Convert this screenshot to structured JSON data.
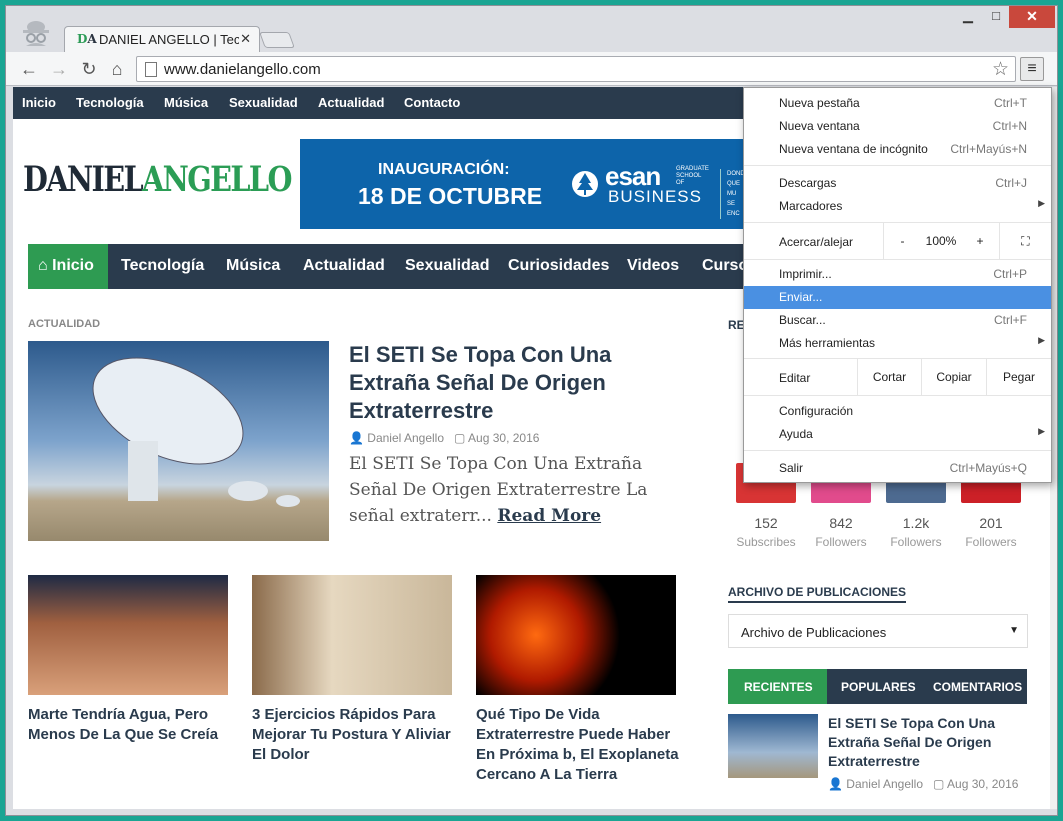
{
  "browser": {
    "tab_title": "DANIEL ANGELLO | Tecnología",
    "tab_favicon": "DA",
    "url": "www.danielangello.com"
  },
  "site": {
    "top_nav": [
      "Inicio",
      "Tecnología",
      "Música",
      "Sexualidad",
      "Actualidad",
      "Contacto"
    ],
    "logo_part1": "DANIEL",
    "logo_part2": "ANGELLO",
    "banner": {
      "line1": "INAUGURACIÓN:",
      "line2": "18 DE OCTUBRE",
      "brand": "esan",
      "brand2": "BUSINESS",
      "tag": "GRADUATE SCHOOL OF",
      "side": [
        "DONDE",
        "QUE MU",
        "SE ENC"
      ]
    },
    "main_nav": [
      "Inicio",
      "Tecnología",
      "Música",
      "Actualidad",
      "Sexualidad",
      "Curiosidades",
      "Videos",
      "Cursos"
    ],
    "section_label": "ACTUALIDAD",
    "featured": {
      "title": "El SETI Se Topa Con Una Extraña Señal De Origen Extraterrestre",
      "author": "Daniel Angello",
      "date": "Aug 30, 2016",
      "excerpt": "El SETI Se Topa Con Una Extraña Señal De Origen Extraterrestre La señal extraterr...",
      "read_more": "Read More"
    },
    "posts": [
      "Marte Tendría Agua, Pero Menos De La Que Se Creía",
      "3 Ejercicios Rápidos Para Mejorar Tu Postura Y Aliviar El Dolor",
      "Qué Tipo De Vida Extraterrestre Puede Haber En Próxima b, El Exoplaneta Cercano A La Tierra"
    ],
    "sidebar_heading_partial": "RE",
    "social": [
      {
        "count": "152",
        "label": "Subscribes",
        "color": "#d83434"
      },
      {
        "count": "842",
        "label": "Followers",
        "color": "#e14b8c"
      },
      {
        "count": "1.2k",
        "label": "Followers",
        "color": "#4d6a90"
      },
      {
        "count": "201",
        "label": "Followers",
        "color": "#cc2027"
      }
    ],
    "archive_heading": "ARCHIVO DE PUBLICACIONES",
    "archive_select": "Archivo de Publicaciones",
    "tabs": [
      "RECIENTES",
      "POPULARES",
      "COMENTARIOS"
    ],
    "recent": {
      "title": "El SETI Se Topa Con Una Extraña Señal De Origen Extraterrestre",
      "author": "Daniel Angello",
      "date": "Aug 30, 2016"
    }
  },
  "menu": {
    "new_tab": "Nueva pestaña",
    "new_tab_sc": "Ctrl+T",
    "new_window": "Nueva ventana",
    "new_window_sc": "Ctrl+N",
    "incognito": "Nueva ventana de incógnito",
    "incognito_sc": "Ctrl+Mayús+N",
    "downloads": "Descargas",
    "downloads_sc": "Ctrl+J",
    "bookmarks": "Marcadores",
    "zoom": "Acercar/alejar",
    "zoom_minus": "-",
    "zoom_value": "100%",
    "zoom_plus": "+",
    "print": "Imprimir...",
    "print_sc": "Ctrl+P",
    "send": "Enviar...",
    "find": "Buscar...",
    "find_sc": "Ctrl+F",
    "more_tools": "Más herramientas",
    "edit": "Editar",
    "cut": "Cortar",
    "copy": "Copiar",
    "paste": "Pegar",
    "settings": "Configuración",
    "help": "Ayuda",
    "exit": "Salir",
    "exit_sc": "Ctrl+Mayús+Q"
  }
}
